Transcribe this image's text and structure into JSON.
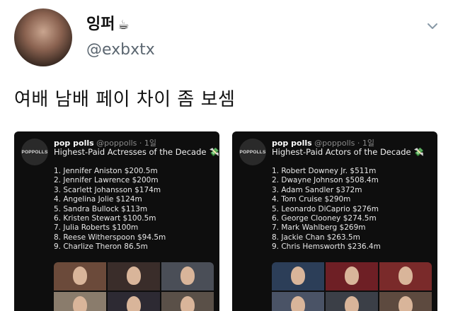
{
  "author": {
    "name": "잉퍼",
    "name_emoji": "☕",
    "handle": "@exbxtx"
  },
  "tweet": {
    "text": "여배 남배 페이 차이 좀 보셈"
  },
  "colors": {
    "background": "#ffffff",
    "card_background": "#0e0e0e",
    "handle_gray": "#5b6670"
  },
  "cards": [
    {
      "logo_text": "POPPOLLS",
      "account_name": "pop polls",
      "account_meta": "@poppolls · 1일",
      "title": "Highest-Paid Actresses of the Decade",
      "title_emoji": "💸",
      "items": [
        "1. Jennifer Aniston $200.5m",
        "2. Jennifer Lawrence $200m",
        "3. Scarlett Johansson $174m",
        "4. Angelina Jolie $124m",
        "5. Sandra Bullock $113m",
        "6. Kristen Stewart $100.5m",
        "7. Julia Roberts $100m",
        "8. Reese Witherspoon $94.5m",
        "9. Charlize Theron 86.5m"
      ],
      "photo_colors": [
        "#6b4a3a",
        "#3a2d2a",
        "#4a4e57",
        "#8a7c6c",
        "#2d2a33",
        "#5a5048"
      ]
    },
    {
      "logo_text": "POPPOLLS",
      "account_name": "pop polls",
      "account_meta": "@poppolls · 1일",
      "title": "Highest-Paid Actors of the Decade",
      "title_emoji": "💸",
      "items": [
        "1. Robert Downey Jr. $511m",
        "2. Dwayne Johnson $508.4m",
        "3. Adam Sandler $372m",
        "4. Tom Cruise $290m",
        "5. Leonardo DiCaprio $276m",
        "6. George Clooney $274.5m",
        "7. Mark Wahlberg $269m",
        "8. Jackie Chan $263.5m",
        "9. Chris Hemsworth $236.4m"
      ],
      "photo_colors": [
        "#2c3e58",
        "#6e1f25",
        "#7a2a2a",
        "#4a5366",
        "#3b3f47",
        "#5d4a3f"
      ]
    }
  ]
}
